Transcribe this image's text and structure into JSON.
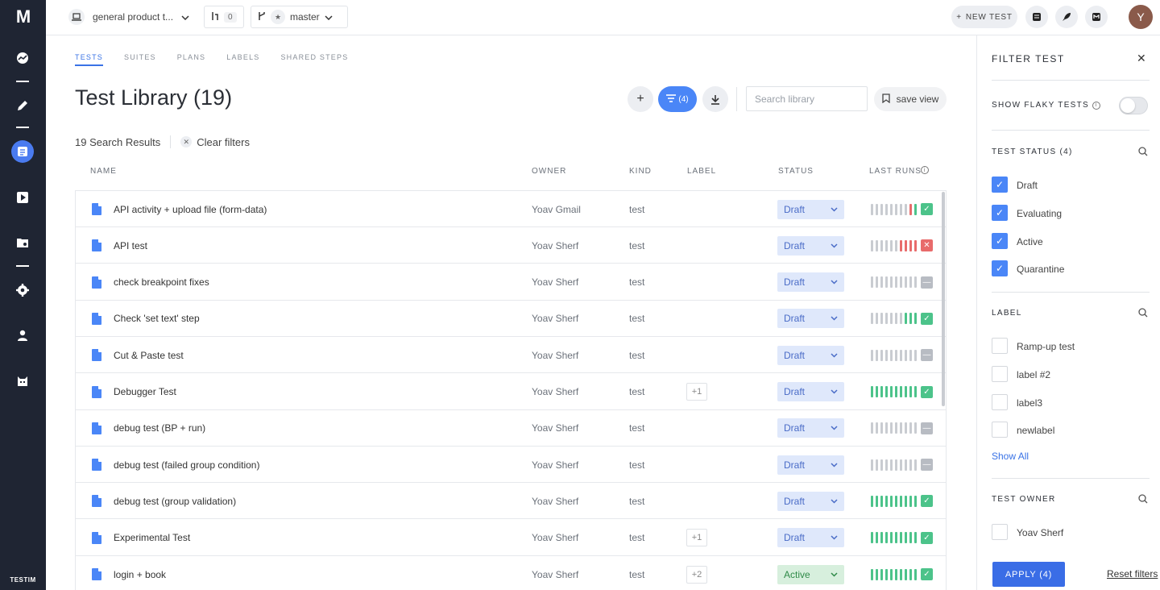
{
  "app": {
    "logo": "M",
    "brand": "TESTIM"
  },
  "topbar": {
    "project": "general product t...",
    "pr_count": "0",
    "branch": "master",
    "new_test": "NEW TEST",
    "user_initial": "Y"
  },
  "tabs": [
    {
      "label": "TESTS",
      "active": true
    },
    {
      "label": "SUITES",
      "active": false
    },
    {
      "label": "PLANS",
      "active": false
    },
    {
      "label": "LABELS",
      "active": false
    },
    {
      "label": "SHARED STEPS",
      "active": false
    }
  ],
  "page": {
    "title": "Test Library (19)",
    "filter_count": "(4)",
    "search_placeholder": "Search library",
    "save_view": "save view",
    "results": "19 Search Results",
    "clear_filters": "Clear filters"
  },
  "columns": {
    "name": "NAME",
    "owner": "OWNER",
    "kind": "KIND",
    "label": "LABEL",
    "status": "STATUS",
    "last_runs": "LAST RUNS"
  },
  "rows": [
    {
      "name": "API activity + upload file (form-data)",
      "owner": "Yoav Gmail",
      "kind": "test",
      "label": "",
      "status": "Draft",
      "runs": "nnnnnnnnrg",
      "result": "pass"
    },
    {
      "name": "API test",
      "owner": "Yoav Sherf",
      "kind": "test",
      "label": "",
      "status": "Draft",
      "runs": "nnnnnnrrrr",
      "result": "fail"
    },
    {
      "name": "check breakpoint fixes",
      "owner": "Yoav Sherf",
      "kind": "test",
      "label": "",
      "status": "Draft",
      "runs": "nnnnnnnnnn",
      "result": "none"
    },
    {
      "name": "Check 'set text' step",
      "owner": "Yoav Sherf",
      "kind": "test",
      "label": "",
      "status": "Draft",
      "runs": "nnnnnnnggg",
      "result": "pass"
    },
    {
      "name": "Cut & Paste test",
      "owner": "Yoav Sherf",
      "kind": "test",
      "label": "",
      "status": "Draft",
      "runs": "nnnnnnnnnn",
      "result": "none"
    },
    {
      "name": "Debugger Test",
      "owner": "Yoav Sherf",
      "kind": "test",
      "label": "+1",
      "status": "Draft",
      "runs": "gggggggggg",
      "result": "pass"
    },
    {
      "name": "debug test (BP + run)",
      "owner": "Yoav Sherf",
      "kind": "test",
      "label": "",
      "status": "Draft",
      "runs": "nnnnnnnnnn",
      "result": "none"
    },
    {
      "name": "debug test (failed group condition)",
      "owner": "Yoav Sherf",
      "kind": "test",
      "label": "",
      "status": "Draft",
      "runs": "nnnnnnnnnn",
      "result": "none"
    },
    {
      "name": "debug test (group validation)",
      "owner": "Yoav Sherf",
      "kind": "test",
      "label": "",
      "status": "Draft",
      "runs": "gggggggggg",
      "result": "pass"
    },
    {
      "name": "Experimental Test",
      "owner": "Yoav Sherf",
      "kind": "test",
      "label": "+1",
      "status": "Draft",
      "runs": "gggggggggg",
      "result": "pass"
    },
    {
      "name": "login + book",
      "owner": "Yoav Sherf",
      "kind": "test",
      "label": "+2",
      "status": "Active",
      "runs": "gggggggggg",
      "result": "pass"
    }
  ],
  "filter": {
    "title": "FILTER TEST",
    "flaky": "SHOW FLAKY TESTS",
    "status_title": "TEST STATUS (4)",
    "statuses": [
      "Draft",
      "Evaluating",
      "Active",
      "Quarantine"
    ],
    "label_title": "LABEL",
    "labels": [
      "Ramp-up test",
      "label #2",
      "label3",
      "newlabel"
    ],
    "show_all": "Show All",
    "owner_title": "TEST OWNER",
    "owners": [
      "Yoav Sherf"
    ],
    "apply": "APPLY (4)",
    "reset": "Reset filters"
  }
}
